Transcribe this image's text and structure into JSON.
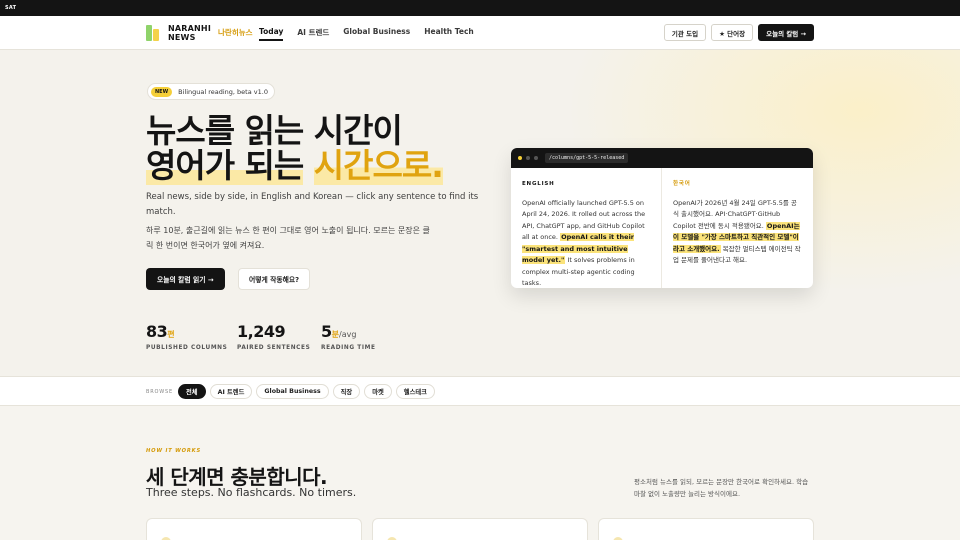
{
  "topbar": {
    "label": "SAT"
  },
  "nav": {
    "logo_line1": "NARANHI",
    "logo_line2": "NEWS",
    "logo_ko": "나란히뉴스",
    "links": [
      {
        "label": "Today",
        "active": true
      },
      {
        "label": "AI 트렌드"
      },
      {
        "label": "Global Business"
      },
      {
        "label": "Health Tech"
      }
    ],
    "btn_org": "기관 도입",
    "btn_vocab": "★ 단어장",
    "btn_today": "오늘의 칼럼 →"
  },
  "hero": {
    "badge_new": "NEW",
    "badge_text": "Bilingual reading, beta v1.0",
    "title_line1": "뉴스를 읽는 시간이",
    "title_line2_a": "영어가 되는",
    "title_line2_b": "시간으로.",
    "sub_en": "Real news, side by side, in English and Korean — click any sentence to find its match.",
    "sub_ko": "하루 10분, 출근길에 읽는 뉴스 한 편이 그대로 영어 노출이 됩니다. 모르는 문장은 클릭 한 번이면 한국어가 옆에 켜져요.",
    "cta_primary": "오늘의 칼럼 읽기 →",
    "cta_secondary": "어떻게 작동해요?",
    "stats": [
      {
        "num": "83",
        "unit": "편",
        "label": "PUBLISHED COLUMNS"
      },
      {
        "num": "1,249",
        "unit": "",
        "label": "PAIRED SENTENCES"
      },
      {
        "num": "5",
        "unit": "분",
        "unit2": "/avg",
        "label": "READING TIME"
      }
    ]
  },
  "card": {
    "url": "/columns/gpt-5-5-released",
    "en_head": "ENGLISH",
    "ko_head": "한국어",
    "en_1": "OpenAI officially launched GPT-5.5 on April 24, 2026.",
    "en_2": "It rolled out across the API, ChatGPT app, and GitHub Copilot all at once.",
    "en_3": "OpenAI calls it their \"smartest and most intuitive model yet.\"",
    "en_4": "It solves problems in complex multi-step agentic coding tasks.",
    "ko_1": "OpenAI가 2026년 4월 24일 GPT-5.5를 공식 출시했어요.",
    "ko_2": "API·ChatGPT·GitHub Copilot 전반에 동시 적용됐어요.",
    "ko_3": "OpenAI는 이 모델을 \"가장 스마트하고 직관적인 모델\"이라고 소개했어요.",
    "ko_4": "복잡한 멀티스텝 에이전틱 작업 문제를 풀어낸다고 해요."
  },
  "browse": {
    "label": "BROWSE",
    "chips": [
      "전체",
      "AI 트렌드",
      "Global Business",
      "직장",
      "마켓",
      "헬스테크"
    ]
  },
  "how": {
    "eyebrow": "HOW IT WORKS",
    "title": "세 단계면 충분합니다.",
    "title_en": "Three steps. No flashcards. No timers.",
    "desc": "평소처럼 뉴스를 읽되, 모르는 문장만 한국어로 확인하세요. 학습 마찰 없이 노출량만 늘리는 방식이에요."
  },
  "colors": {
    "accent": "#e0a310",
    "highlight": "#fbe37a",
    "dark": "#141414"
  }
}
